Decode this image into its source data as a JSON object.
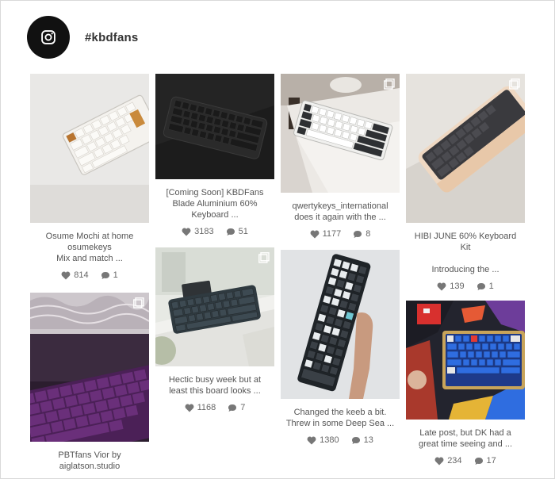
{
  "feed": {
    "hashtag": "#kbdfans",
    "avatar_icon": "instagram-icon"
  },
  "posts": [
    {
      "caption": "Osume Mochi at home\nosumekeys\nMix and match ...",
      "likes": "814",
      "comments": "1",
      "multi": false
    },
    {
      "caption": "PBTfans Vior by\naiglatson.studio",
      "likes": "",
      "comments": "",
      "multi": true
    },
    {
      "caption": "[Coming Soon] KBDFans\nBlade Aluminium 60%\nKeyboard ...",
      "likes": "3183",
      "comments": "51",
      "multi": false
    },
    {
      "caption": "Hectic busy week but at\nleast this board looks ...",
      "likes": "1168",
      "comments": "7",
      "multi": true
    },
    {
      "caption": "qwertykeys_international\ndoes it again with the ...",
      "likes": "1177",
      "comments": "8",
      "multi": true
    },
    {
      "caption": "Changed the keeb a bit.\nThrew in some Deep Sea ...",
      "likes": "1380",
      "comments": "13",
      "multi": false
    },
    {
      "caption": "HIBI JUNE 60% Keyboard\nKit\n\nIntroducing the ...",
      "likes": "139",
      "comments": "1",
      "multi": true
    },
    {
      "caption": "Late post, but DK had a\ngreat time seeing and ...",
      "likes": "234",
      "comments": "17",
      "multi": false
    }
  ],
  "colors": {
    "avatar_bg": "#111111",
    "text": "#555555",
    "icon": "#777777"
  },
  "icons": {
    "likes": "heart-icon",
    "comments": "comment-icon",
    "carousel": "multiple-images-icon"
  }
}
